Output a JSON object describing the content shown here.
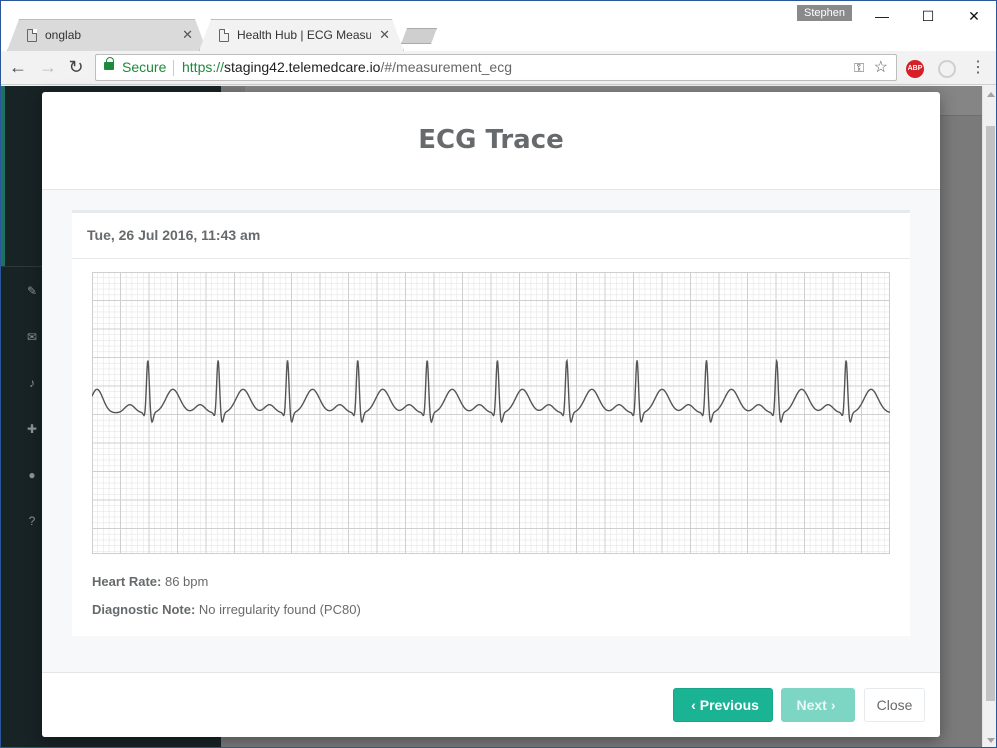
{
  "browser": {
    "tabs": [
      {
        "title": "onglab",
        "close": "✕"
      },
      {
        "title": "Health Hub | ECG Measur",
        "close": "✕"
      }
    ],
    "profile": "Stephen",
    "window_controls": {
      "minimize": "—",
      "maximize": "☐",
      "close": "✕"
    },
    "nav": {
      "back": "←",
      "forward": "→",
      "reload": "↻"
    },
    "address": {
      "security_label": "Secure",
      "url_scheme": "https://",
      "url_host": "staging42.telemedcare.io",
      "url_path": "/#/measurement_ecg"
    },
    "extensions": {
      "abp_label": "ABP"
    },
    "menu": "⋮"
  },
  "page": {
    "sidebar_icons": [
      "edit-icon",
      "envelope-icon",
      "bell-icon",
      "briefcase-medical-icon",
      "user-icon",
      "question-circle-icon"
    ]
  },
  "modal": {
    "title": "ECG Trace",
    "card": {
      "date": "Tue, 26 Jul 2016, 11:43 am",
      "heart_rate_label": "Heart Rate:",
      "heart_rate_value": "86 bpm",
      "diagnostic_label": "Diagnostic Note:",
      "diagnostic_value": "No irregularity found (PC80)"
    },
    "buttons": {
      "previous": "Previous",
      "next": "Next",
      "close": "Close",
      "previous_icon": "‹",
      "next_icon": "›"
    },
    "trace_color": "#555555",
    "grid_minor_color": "#e6e6e6",
    "grid_major_color": "#cfcfcf"
  },
  "chart_data": {
    "type": "line",
    "title": "",
    "xlabel": "",
    "ylabel": "",
    "beats": 12,
    "beat_times": [
      0.07,
      0.158,
      0.245,
      0.333,
      0.42,
      0.508,
      0.595,
      0.683,
      0.77,
      0.858,
      0.945
    ],
    "baseline": 0.5,
    "r_peak": 0.57,
    "t_wave": 0.14,
    "grid": true
  }
}
